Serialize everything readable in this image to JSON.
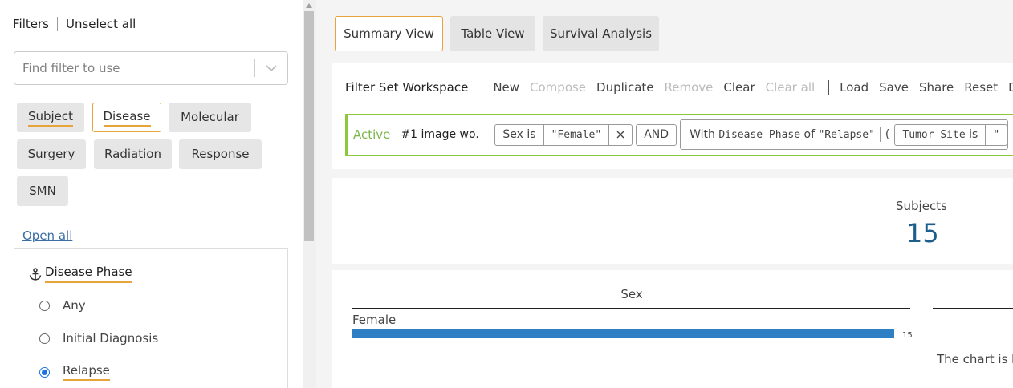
{
  "filters_panel": {
    "title": "Filters",
    "unselect_all": "Unselect all",
    "search_placeholder": "Find filter to use",
    "tabs": [
      "Subject",
      "Disease",
      "Molecular",
      "Surgery",
      "Radiation",
      "Response",
      "SMN"
    ],
    "active_tab": "Disease",
    "open_all": "Open all",
    "section": {
      "title": "Disease Phase",
      "options": [
        "Any",
        "Initial Diagnosis",
        "Relapse"
      ],
      "selected": "Relapse"
    }
  },
  "views": {
    "tabs": [
      "Summary View",
      "Table View",
      "Survival Analysis"
    ],
    "active": "Summary View"
  },
  "workspace": {
    "title": "Filter Set Workspace",
    "actions_group1": [
      {
        "label": "New",
        "disabled": false
      },
      {
        "label": "Compose",
        "disabled": true
      },
      {
        "label": "Duplicate",
        "disabled": false
      },
      {
        "label": "Remove",
        "disabled": true
      },
      {
        "label": "Clear",
        "disabled": false
      },
      {
        "label": "Clear all",
        "disabled": true
      }
    ],
    "actions_group2": [
      "Load",
      "Save",
      "Share",
      "Reset",
      "De"
    ],
    "active_label": "Active",
    "filter_name": "#1 image wo...",
    "pill_sex": {
      "field": "Sex",
      "op": "is",
      "value": "\"Female\""
    },
    "and_label": "AND",
    "pill_phase": {
      "prefix": "With",
      "field": "Disease Phase",
      "of": "of",
      "value": "\"Relapse\""
    },
    "paren_open": "(",
    "pill_tumor": {
      "field": "Tumor Site",
      "op": "is",
      "value": "\""
    }
  },
  "stats": {
    "subjects_label": "Subjects",
    "subjects_value": "15"
  },
  "chart_data": {
    "type": "bar",
    "title": "Sex",
    "categories": [
      "Female"
    ],
    "values": [
      15
    ],
    "xlim": [
      0,
      15
    ],
    "colors": {
      "bar": "#2f7fc4"
    }
  },
  "chart_message": "The chart is h"
}
